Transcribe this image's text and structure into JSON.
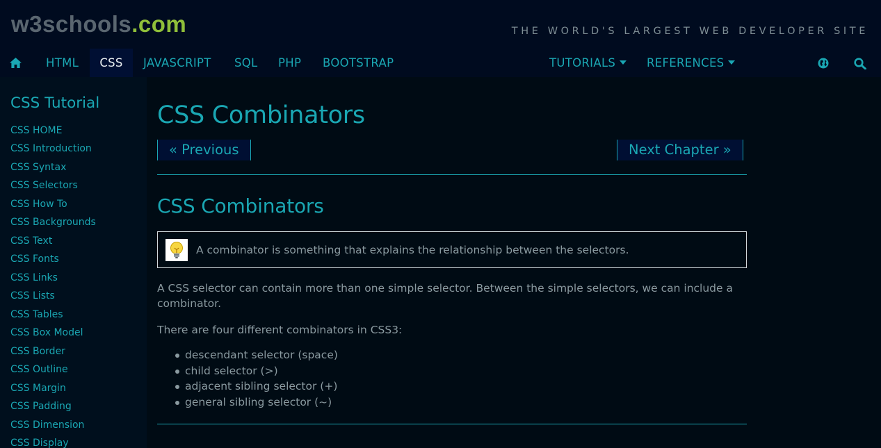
{
  "header": {
    "logo_main": "w3schools",
    "logo_tld": ".com",
    "tagline": "THE WORLD'S LARGEST WEB DEVELOPER SITE"
  },
  "topnav": {
    "items": [
      {
        "label": "HTML"
      },
      {
        "label": "CSS"
      },
      {
        "label": "JAVASCRIPT"
      },
      {
        "label": "SQL"
      },
      {
        "label": "PHP"
      },
      {
        "label": "BOOTSTRAP"
      }
    ],
    "active": "CSS",
    "dropdowns": [
      {
        "label": "TUTORIALS"
      },
      {
        "label": "REFERENCES"
      }
    ],
    "icons": [
      "home-icon",
      "globe-icon",
      "search-icon"
    ]
  },
  "sidebar": {
    "title": "CSS Tutorial",
    "links": [
      "CSS HOME",
      "CSS Introduction",
      "CSS Syntax",
      "CSS Selectors",
      "CSS How To",
      "CSS Backgrounds",
      "CSS Text",
      "CSS Fonts",
      "CSS Links",
      "CSS Lists",
      "CSS Tables",
      "CSS Box Model",
      "CSS Border",
      "CSS Outline",
      "CSS Margin",
      "CSS Padding",
      "CSS Dimension",
      "CSS Display"
    ]
  },
  "main": {
    "title": "CSS Combinators",
    "prev_label": "« Previous",
    "next_label": "Next Chapter »",
    "section_title": "CSS Combinators",
    "note_icon": "lightbulb-icon",
    "note_text": "A combinator is something that explains the relationship between the selectors.",
    "paragraph1": "A CSS selector can contain more than one simple selector. Between the simple selectors, we can include a combinator.",
    "paragraph2": "There are four different combinators in CSS3:",
    "combinators": [
      "descendant selector (space)",
      "child selector (>)",
      "adjacent sibling selector (+)",
      "general sibling selector (~)"
    ]
  },
  "colors": {
    "accent": "#1aa7b3",
    "header_bg": "#000b1f",
    "page_bg": "#000b14",
    "sidebar_bg": "#000f1d",
    "logo_green": "#8fbf3a"
  }
}
